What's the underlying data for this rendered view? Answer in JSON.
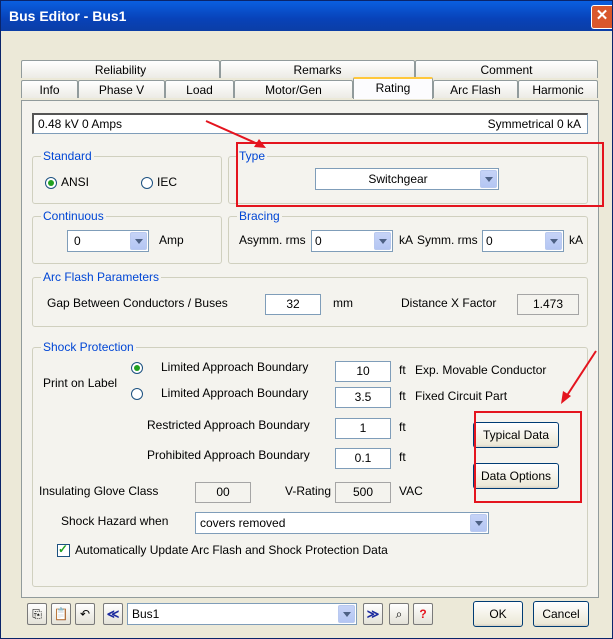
{
  "window": {
    "title": "Bus Editor - Bus1"
  },
  "tabs_top": [
    "Reliability",
    "Remarks",
    "Comment"
  ],
  "tabs_bottom": [
    "Info",
    "Phase V",
    "Load",
    "Motor/Gen",
    "Rating",
    "Arc Flash",
    "Harmonic"
  ],
  "active_tab": "Rating",
  "info": {
    "left": "0.48 kV  0 Amps",
    "right": "Symmetrical 0 kA"
  },
  "standard": {
    "legend": "Standard",
    "ansi": "ANSI",
    "iec": "IEC",
    "selected": "ANSI"
  },
  "type": {
    "legend": "Type",
    "value": "Switchgear"
  },
  "continuous": {
    "legend": "Continuous",
    "value": "0",
    "unit": "Amp"
  },
  "bracing": {
    "legend": "Bracing",
    "asym_label": "Asymm. rms",
    "asym_value": "0",
    "symm_label": "Symm. rms",
    "symm_value": "0",
    "unit": "kA"
  },
  "arc": {
    "legend": "Arc Flash Parameters",
    "gap_label": "Gap Between Conductors / Buses",
    "gap_value": "32",
    "gap_unit": "mm",
    "dx_label": "Distance X Factor",
    "dx_value": "1.473"
  },
  "shock": {
    "legend": "Shock Protection",
    "print_label": "Print on Label",
    "lab1_label": "Limited Approach Boundary",
    "lab1_value": "10",
    "lab1_unit": "ft",
    "lab1_note": "Exp. Movable Conductor",
    "lab2_label": "Limited Approach Boundary",
    "lab2_value": "3.5",
    "lab2_unit": "ft",
    "lab2_note": "Fixed Circuit Part",
    "rab_label": "Restricted Approach Boundary",
    "rab_value": "1",
    "rab_unit": "ft",
    "pab_label": "Prohibited Approach Boundary",
    "pab_value": "0.1",
    "pab_unit": "ft",
    "typical_btn": "Typical Data",
    "options_btn": "Data Options",
    "glove_label": "Insulating Glove Class",
    "glove_value": "00",
    "vrating_label": "V-Rating",
    "vrating_value": "500",
    "vrating_unit": "VAC",
    "hazard_label": "Shock Hazard when",
    "hazard_value": "covers removed",
    "auto_label": "Automatically Update Arc Flash and Shock Protection Data"
  },
  "footer": {
    "bus_value": "Bus1",
    "ok": "OK",
    "cancel": "Cancel"
  },
  "colors": {
    "accent": "#0046d5",
    "highlight": "#e4141e",
    "title_bar": "#0842b8"
  }
}
